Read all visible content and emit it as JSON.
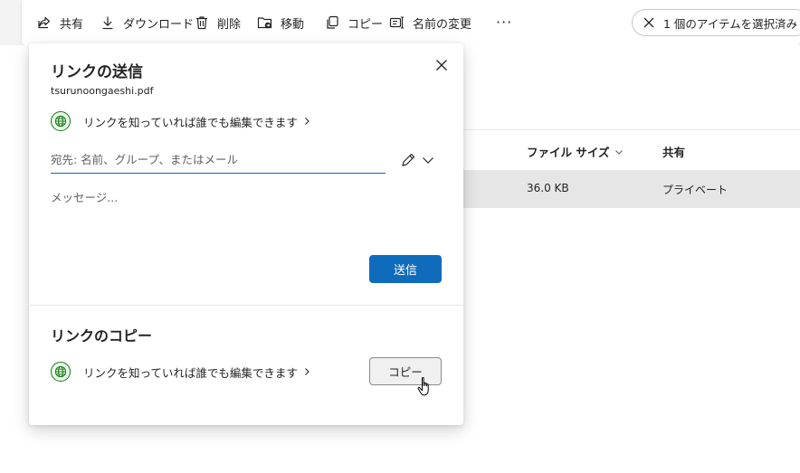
{
  "toolbar": {
    "share_label": "共有",
    "download_label": "ダウンロード",
    "delete_label": "削除",
    "move_label": "移動",
    "copy_label": "コピー",
    "rename_label": "名前の変更",
    "more_label": "···",
    "selection_label": "1 個のアイテムを選択済み"
  },
  "file_list": {
    "columns": [
      "ファイル サイズ",
      "共有"
    ],
    "rows": [
      {
        "size": "36.0 KB",
        "sharing": "プライベート"
      }
    ]
  },
  "dialog": {
    "title": "リンクの送信",
    "filename": "tsurunoongaeshi.pdf",
    "permission_label": "リンクを知っていれば誰でも編集できます",
    "recipient_placeholder": "宛先: 名前、グループ、またはメール",
    "message_placeholder": "メッセージ...",
    "send_label": "送信",
    "copy_section_title": "リンクのコピー",
    "copy_permission_label": "リンクを知っていれば誰でも編集できます",
    "copy_button_label": "コピー"
  },
  "colors": {
    "accent": "#0f6cbd",
    "globe": "#107c10",
    "selected_row": "#e6e6e6"
  },
  "icons": {
    "share": "share-icon",
    "download": "download-icon",
    "delete": "trash-icon",
    "move": "move-folder-icon",
    "copy": "copy-icon",
    "rename": "rename-icon",
    "clear_selection": "close-icon",
    "close": "close-icon",
    "globe": "globe-icon",
    "edit": "pencil-icon",
    "dropdown": "chevron-down-icon"
  }
}
